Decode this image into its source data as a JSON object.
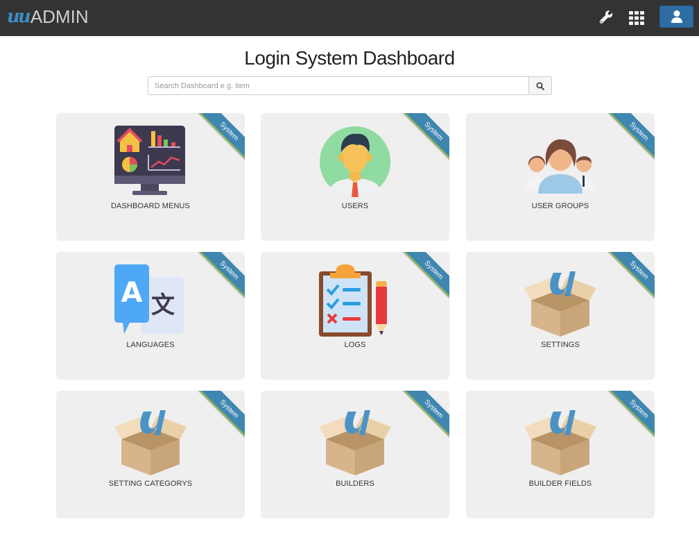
{
  "header": {
    "logo_mark": "u",
    "logo_text": "ADMIN",
    "wrench_icon": "wrench-icon",
    "apps_icon": "grid-apps-icon",
    "user_icon": "user-icon",
    "user_button_color": "#2e6da4"
  },
  "page": {
    "title": "Login System Dashboard",
    "search_placeholder": "Search Dashboard e.g. item",
    "search_icon": "search-icon"
  },
  "cards": [
    {
      "label": "DASHBOARD MENUS",
      "badge": "System",
      "icon": "dashboard-monitor-icon"
    },
    {
      "label": "USERS",
      "badge": "System",
      "icon": "user-avatar-icon"
    },
    {
      "label": "USER GROUPS",
      "badge": "System",
      "icon": "user-group-icon"
    },
    {
      "label": "LANGUAGES",
      "badge": "System",
      "icon": "translate-icon"
    },
    {
      "label": "LOGS",
      "badge": "System",
      "icon": "clipboard-checklist-icon"
    },
    {
      "label": "SETTINGS",
      "badge": "System",
      "icon": "package-box-icon"
    },
    {
      "label": "SETTING CATEGORYS",
      "badge": "System",
      "icon": "package-box-icon"
    },
    {
      "label": "BUILDERS",
      "badge": "System",
      "icon": "package-box-icon"
    },
    {
      "label": "BUILDER FIELDS",
      "badge": "System",
      "icon": "package-box-icon"
    }
  ],
  "colors": {
    "topbar": "#333333",
    "card_bg": "#efefef",
    "ribbon": "#3f86b0",
    "accent_u": "#3a8fc8"
  }
}
